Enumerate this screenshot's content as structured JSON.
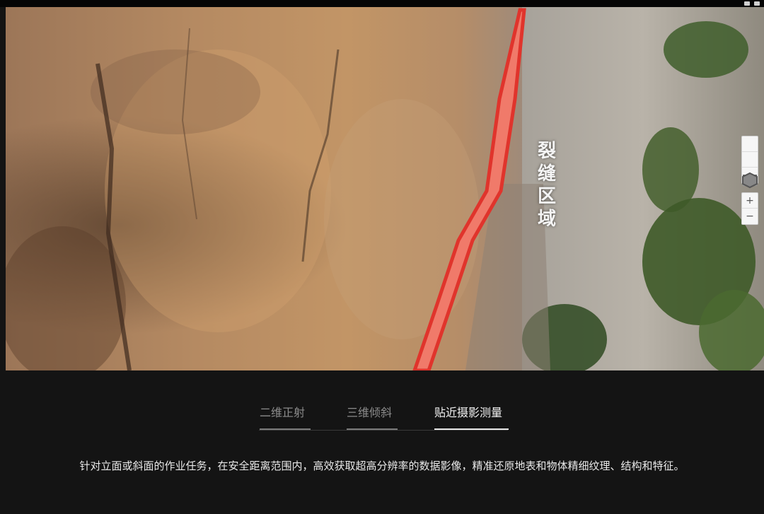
{
  "viewer": {
    "overlay_label": "裂缝区域",
    "controls": {
      "view_icons": [
        "layers-icon",
        "cube-icon",
        "cube-shaded-icon"
      ],
      "zoom_in_label": "+",
      "zoom_out_label": "−"
    },
    "colors": {
      "crack_outline": "#e0342c",
      "crack_fill": "#f07a6a"
    }
  },
  "tabs": [
    {
      "label": "二维正射",
      "active": false
    },
    {
      "label": "三维倾斜",
      "active": false
    },
    {
      "label": "贴近摄影测量",
      "active": true
    }
  ],
  "description": "针对立面或斜面的作业任务，在安全距离范围内，高效获取超高分辨率的数据影像，精准还原地表和物体精细纹理、结构和特征。"
}
